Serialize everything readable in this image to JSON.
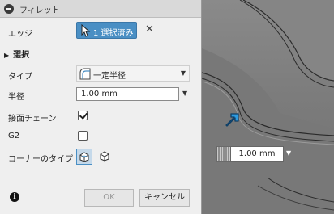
{
  "dialog": {
    "title": "フィレット",
    "edge_label": "エッジ",
    "edge_selection": "1 選択済み",
    "section_title": "選択",
    "type_label": "タイプ",
    "type_value": "一定半径",
    "radius_label": "半径",
    "radius_value": "1.00 mm",
    "tangent_chain_label": "接面チェーン",
    "tangent_chain_checked": true,
    "g2_label": "G2",
    "g2_checked": false,
    "corner_type_label": "コーナーのタイプ",
    "ok_label": "OK",
    "cancel_label": "キャンセル"
  },
  "icons": {
    "collapse": "minus-circle-icon",
    "cursor": "arrow-cursor-icon",
    "clear": "close-icon",
    "section_expand": "triangle-right-icon",
    "fillet_type": "fillet-shape-icon",
    "dropdown": "chevron-down-icon",
    "corner_rolling_ball": "corner-rolling-ball-icon",
    "corner_setback": "corner-setback-icon",
    "info": "info-icon",
    "manipulator": "blue-arrow-manipulator-icon"
  },
  "canvas": {
    "radius_input_value": "1.00 mm"
  },
  "colors": {
    "accent": "#4a8fc4",
    "manipulator": "#2d9be0",
    "dialog_bg": "#efefef"
  }
}
